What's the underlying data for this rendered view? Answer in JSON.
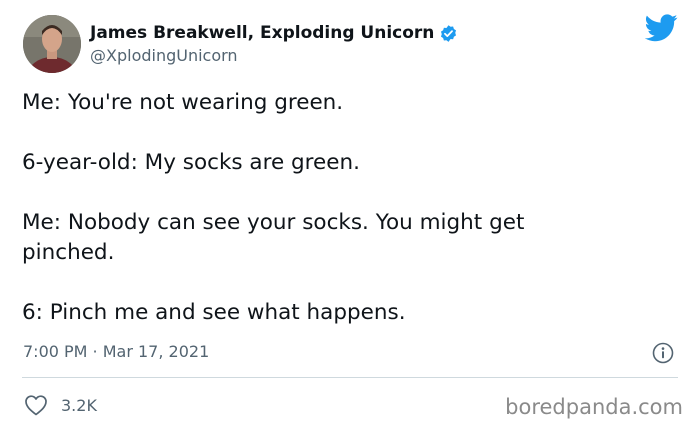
{
  "author": {
    "display_name": "James Breakwell, Exploding Unicorn",
    "handle": "@XplodingUnicorn",
    "avatar_icon": "avatar-photo",
    "verified_icon": "verified-badge-icon"
  },
  "brand": {
    "logo_icon": "twitter-bird-icon",
    "accent_color": "#1d9bf0"
  },
  "tweet": {
    "lines": [
      "Me: You're not wearing green.",
      "6-year-old: My socks are green.",
      "Me: Nobody can see your socks. You might get",
      "pinched.",
      "6: Pinch me and see what happens."
    ],
    "timestamp": "7:00 PM · Mar 17, 2021"
  },
  "actions": {
    "info_icon": "info-icon",
    "like_icon": "heart-icon",
    "like_count": "3.2K"
  },
  "watermark": "boredpanda.com"
}
